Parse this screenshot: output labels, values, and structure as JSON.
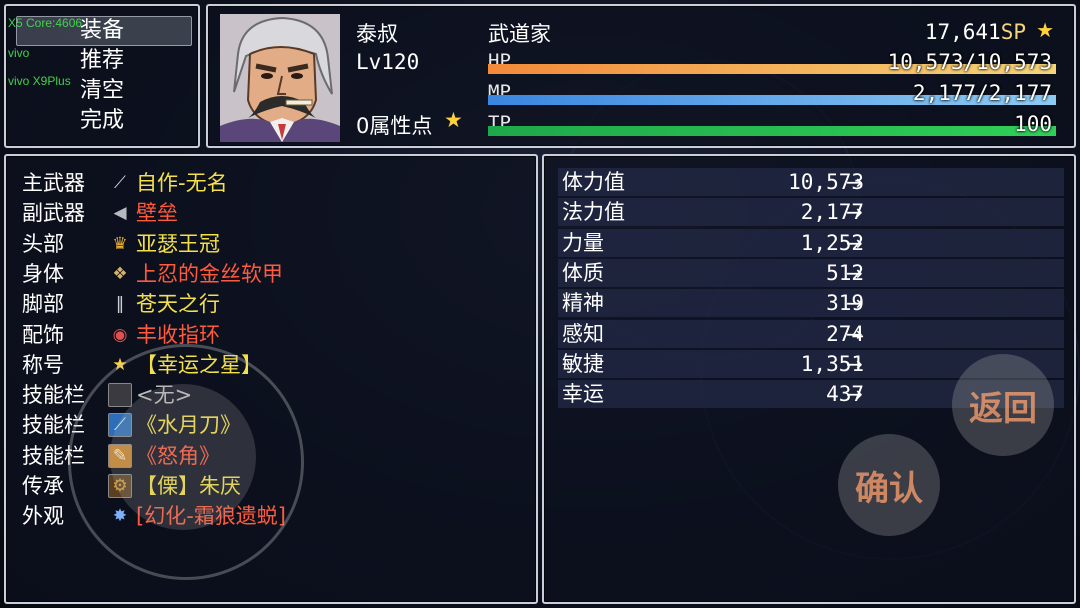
{
  "menu": {
    "items": [
      "装备",
      "推荐",
      "清空",
      "完成"
    ],
    "debug": [
      "X5 Core:4606",
      "vivo",
      "vivo X9Plus"
    ]
  },
  "actor": {
    "name": "泰叔",
    "level": "Lv120",
    "class": "武道家",
    "attr_points": "0属性点",
    "sp_value": "17,641",
    "sp_label": "SP",
    "hp_label": "HP",
    "hp_value": "10,573/10,573",
    "hp_fraction": 1.0,
    "mp_label": "MP",
    "mp_value": "2,177/2,177",
    "mp_fraction": 1.0,
    "tp_label": "TP",
    "tp_value": "100",
    "tp_fraction": 1.0
  },
  "equipment": [
    {
      "slot": "主武器",
      "item": "自作-无名",
      "icon": "sword-icon",
      "color": "#f4e04a"
    },
    {
      "slot": "副武器",
      "item": "壁垒",
      "icon": "axe-icon",
      "color": "#ff5a3c"
    },
    {
      "slot": "头部",
      "item": "亚瑟王冠",
      "icon": "crown-icon",
      "color": "#f4e04a"
    },
    {
      "slot": "身体",
      "item": "上忍的金丝软甲",
      "icon": "armor-icon",
      "color": "#ff5a3c"
    },
    {
      "slot": "脚部",
      "item": "苍天之行",
      "icon": "boots-icon",
      "color": "#f4e04a"
    },
    {
      "slot": "配饰",
      "item": "丰收指环",
      "icon": "ring-icon",
      "color": "#ff5a3c"
    },
    {
      "slot": "称号",
      "item": "【幸运之星】",
      "icon": "star-icon",
      "color": "#f4e04a"
    },
    {
      "slot": "技能栏",
      "item": "<无>",
      "icon": "empty-slot-icon",
      "color": "#bbbbbb"
    },
    {
      "slot": "技能栏",
      "item": "《水月刀》",
      "icon": "blade-skill-icon",
      "color": "#f4e04a"
    },
    {
      "slot": "技能栏",
      "item": "《怒角》",
      "icon": "horn-skill-icon",
      "color": "#ff5a3c"
    },
    {
      "slot": "传承",
      "item": "【傈】朱厌",
      "icon": "gear-icon",
      "color": "#f4e04a"
    },
    {
      "slot": "外观",
      "item": "[幻化-霜狼遗蜕]",
      "icon": "wolf-icon",
      "color": "#ff5a3c"
    }
  ],
  "stats": [
    {
      "name": "体力值",
      "value": "10,573",
      "arrow": "→"
    },
    {
      "name": "法力值",
      "value": "2,177",
      "arrow": "→"
    },
    {
      "name": "力量",
      "value": "1,252",
      "arrow": "→"
    },
    {
      "name": "体质",
      "value": "512",
      "arrow": "→"
    },
    {
      "name": "精神",
      "value": "319",
      "arrow": "→"
    },
    {
      "name": "感知",
      "value": "274",
      "arrow": "→"
    },
    {
      "name": "敏捷",
      "value": "1,351",
      "arrow": "→"
    },
    {
      "name": "幸运",
      "value": "437",
      "arrow": "→"
    }
  ],
  "buttons": {
    "back": "返回",
    "confirm": "确认"
  },
  "colors": {
    "hp_start": "#f28a3a",
    "hp_end": "#f5d57a",
    "mp_start": "#3a86e0",
    "mp_end": "#8ecbf3",
    "tp_start": "#1fa84a",
    "tp_end": "#2fd058",
    "item_yellow": "#f4e04a",
    "item_red": "#ff5a3c"
  }
}
